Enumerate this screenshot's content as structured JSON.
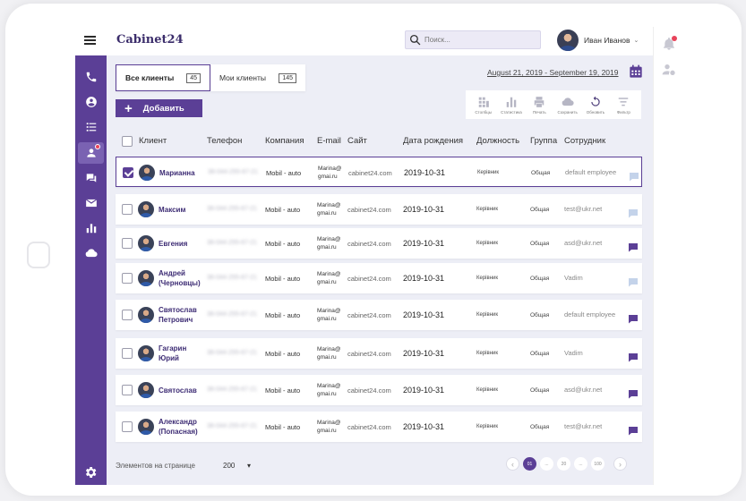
{
  "app": {
    "logo": "Cabinet24"
  },
  "search": {
    "placeholder": "Поиск..."
  },
  "user": {
    "name": "Иван Иванов"
  },
  "tabs": [
    {
      "label": "Все клиенты",
      "count": "45"
    },
    {
      "label": "Мои клиенты",
      "count": "145"
    }
  ],
  "daterange": "August 21, 2019 - September 19, 2019",
  "add_button": {
    "label": "Добавить"
  },
  "toolbar": [
    {
      "label": "Столбцы",
      "icon": "columns-icon"
    },
    {
      "label": "Статистика",
      "icon": "stats-icon"
    },
    {
      "label": "Печать",
      "icon": "print-icon"
    },
    {
      "label": "Сохранить",
      "icon": "cloud-save-icon"
    },
    {
      "label": "Обновить",
      "icon": "refresh-icon"
    },
    {
      "label": "Фильтр",
      "icon": "filter-icon"
    }
  ],
  "table": {
    "headers": {
      "client": "Клиент",
      "phone": "Телефон",
      "company": "Компания",
      "email": "E-mail",
      "site": "Сайт",
      "dob": "Дата рождения",
      "position": "Должность",
      "group": "Группа",
      "employee": "Сотрудник"
    },
    "rows": [
      {
        "name1": "Марианна",
        "name2": "",
        "phone": "38-044-255-67-21",
        "company": "Mobil - auto",
        "email1": "Marina@",
        "email2": "gmai.ru",
        "site": "cabinet24.com",
        "dob": "2019-10-31",
        "position": "Керівник",
        "group": "Общая",
        "employee": "default employee",
        "checked": true,
        "chat_active": false
      },
      {
        "name1": "Максим",
        "name2": "",
        "phone": "38-044-255-67-21",
        "company": "Mobil - auto",
        "email1": "Marina@",
        "email2": "gmai.ru",
        "site": "cabinet24.com",
        "dob": "2019-10-31",
        "position": "Керівник",
        "group": "Общая",
        "employee": "test@ukr.net",
        "checked": false,
        "chat_active": false
      },
      {
        "name1": "Евгения",
        "name2": "",
        "phone": "38-044-255-67-21",
        "company": "Mobil - auto",
        "email1": "Marina@",
        "email2": "gmai.ru",
        "site": "cabinet24.com",
        "dob": "2019-10-31",
        "position": "Керівник",
        "group": "Общая",
        "employee": "asd@ukr.net",
        "checked": false,
        "chat_active": true
      },
      {
        "name1": "Андрей",
        "name2": "(Черновцы)",
        "phone": "38-044-255-67-21",
        "company": "Mobil - auto",
        "email1": "Marina@",
        "email2": "gmai.ru",
        "site": "cabinet24.com",
        "dob": "2019-10-31",
        "position": "Керівник",
        "group": "Общая",
        "employee": "Vadim",
        "checked": false,
        "chat_active": false
      },
      {
        "name1": "Святослав",
        "name2": "Петрович",
        "phone": "38-044-255-67-21",
        "company": "Mobil - auto",
        "email1": "Marina@",
        "email2": "gmai.ru",
        "site": "cabinet24.com",
        "dob": "2019-10-31",
        "position": "Керівник",
        "group": "Общая",
        "employee": "default employee",
        "checked": false,
        "chat_active": true
      },
      {
        "name1": "Гагарин",
        "name2": "Юрий",
        "phone": "38-044-255-67-21",
        "company": "Mobil - auto",
        "email1": "Marina@",
        "email2": "gmai.ru",
        "site": "cabinet24.com",
        "dob": "2019-10-31",
        "position": "Керівник",
        "group": "Общая",
        "employee": "Vadim",
        "checked": false,
        "chat_active": true
      },
      {
        "name1": "Святослав",
        "name2": "",
        "phone": "38-044-255-67-21",
        "company": "Mobil - auto",
        "email1": "Marina@",
        "email2": "gmai.ru",
        "site": "cabinet24.com",
        "dob": "2019-10-31",
        "position": "Керівник",
        "group": "Общая",
        "employee": "asd@ukr.net",
        "checked": false,
        "chat_active": true
      },
      {
        "name1": "Александр",
        "name2": "(Попасная)",
        "phone": "38-044-255-67-21",
        "company": "Mobil - auto",
        "email1": "Marina@",
        "email2": "gmai.ru",
        "site": "cabinet24.com",
        "dob": "2019-10-31",
        "position": "Керівник",
        "group": "Общая",
        "employee": "test@ukr.net",
        "checked": false,
        "chat_active": true
      }
    ]
  },
  "pagination": {
    "per_page_label": "Элементов на странице",
    "per_page_value": "200",
    "pages": [
      "01",
      "...",
      "20",
      "...",
      "100"
    ],
    "current": "01"
  },
  "colors": {
    "accent": "#5b3f96",
    "call": "#22b24c",
    "badge": "#e8435a"
  }
}
